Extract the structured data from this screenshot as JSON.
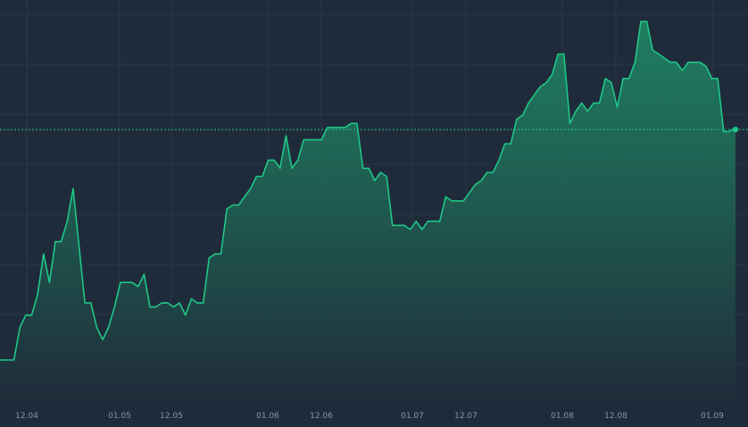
{
  "colors": {
    "background": "#1f2b3a",
    "grid": "#2a3747",
    "line": "#1fc787",
    "fill_top": "#1f8c66",
    "fill_bottom": "#1f2b3a",
    "tick_text": "#8b95a3"
  },
  "chart_data": {
    "type": "area",
    "title": "",
    "xlabel": "",
    "ylabel": "",
    "grid": true,
    "legend": "none",
    "x_ticks": [
      "12.04",
      "01.05",
      "12.05",
      "01.06",
      "12.06",
      "01.07",
      "12.07",
      "01.08",
      "12.08",
      "01.09"
    ],
    "ylim": [
      0,
      100
    ],
    "last_value": 73.5,
    "series": [
      {
        "values": [
          17,
          17,
          25,
          28,
          28,
          33,
          43,
          36,
          46,
          46,
          51,
          59,
          45,
          31,
          31,
          25,
          22,
          25,
          30,
          36,
          36,
          36,
          35,
          38,
          30,
          30,
          31,
          31,
          30,
          31,
          28,
          32,
          31,
          31,
          42,
          43,
          43,
          54,
          55,
          55,
          57,
          59,
          62,
          62,
          66,
          66,
          64,
          72,
          64,
          66,
          71,
          71,
          71,
          71,
          74,
          74,
          74,
          74,
          75,
          75,
          64,
          64,
          61,
          63,
          62,
          50,
          50,
          50,
          49,
          51,
          49,
          51,
          51,
          51,
          57,
          56,
          56,
          56,
          58,
          60,
          61,
          63,
          63,
          66,
          70,
          70,
          76,
          77,
          80,
          82,
          84,
          85,
          87,
          92,
          92,
          75,
          78,
          80,
          78,
          80,
          80,
          86,
          85,
          79,
          86,
          86,
          90,
          100,
          100,
          93,
          92,
          91,
          90,
          90,
          88,
          90,
          90,
          90,
          89,
          86,
          86,
          73,
          73,
          74
        ]
      }
    ]
  }
}
